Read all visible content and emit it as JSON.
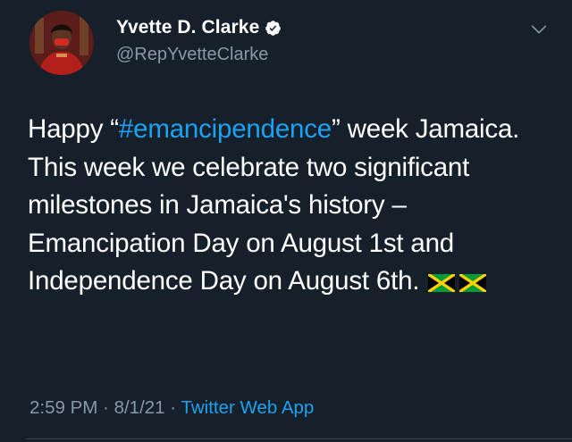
{
  "author": {
    "display_name": "Yvette D. Clarke",
    "handle": "@RepYvetteClarke",
    "avatar_icon": "profile-photo",
    "verified_icon": "verified-badge-icon"
  },
  "tweet": {
    "text_before_hashtag": "Happy “",
    "hashtag": "#emancipendence",
    "text_after_hashtag": "” week Jamaica. This week we celebrate two significant milestones in Jamaica's history – Emancipation Day on August 1st and Independence Day on August 6th.",
    "emoji": [
      "jamaica-flag-icon",
      "jamaica-flag-icon"
    ]
  },
  "meta": {
    "time": "2:59 PM",
    "separator": " · ",
    "date": "8/1/21",
    "source": "Twitter Web App"
  },
  "colors": {
    "background": "#15202b",
    "text": "#ffffff",
    "secondary": "#8899a6",
    "accent": "#1da1f2"
  }
}
